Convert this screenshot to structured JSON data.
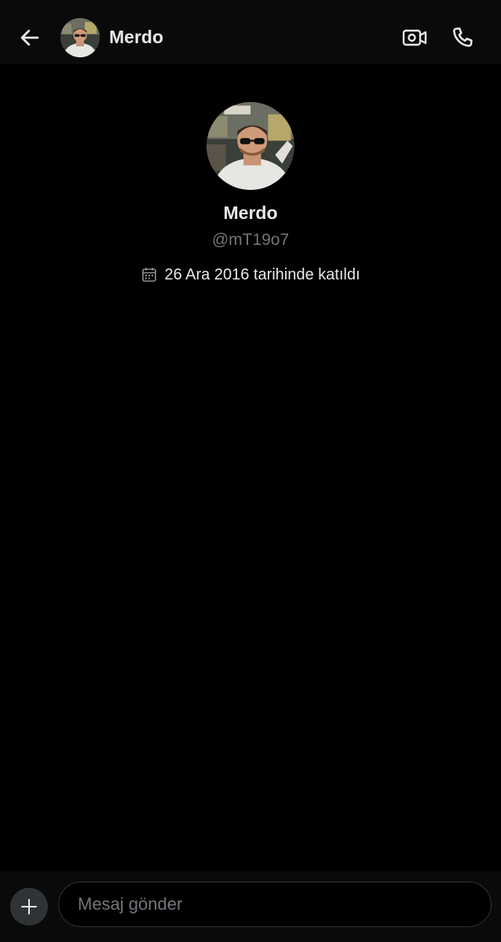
{
  "header": {
    "name": "Merdo",
    "back_icon": "arrow-left-icon",
    "video_icon": "video-call-icon",
    "call_icon": "phone-icon"
  },
  "profile": {
    "name": "Merdo",
    "handle": "@mT19o7",
    "joined": "26 Ara 2016 tarihinde katıldı",
    "calendar_icon": "calendar-icon"
  },
  "composer": {
    "placeholder": "Mesaj gönder",
    "add_icon": "plus-icon"
  },
  "colors": {
    "background": "#000000",
    "bar_background": "#0a0a0a",
    "primary_text": "#e7e9ea",
    "secondary_text": "#71767b",
    "border": "#2f3336"
  }
}
